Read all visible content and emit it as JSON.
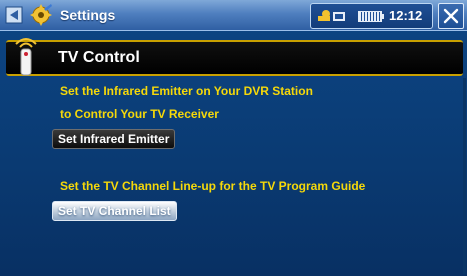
{
  "titlebar": {
    "title": "Settings",
    "clock": "12:12"
  },
  "header": {
    "title": "TV Control"
  },
  "section1": {
    "line1": "Set the Infrared Emitter on Your DVR Station",
    "line2": "to Control Your TV Receiver",
    "button_label": "Set Infrared Emitter"
  },
  "section2": {
    "line1": "Set the TV Channel Line-up for the TV Program Guide",
    "button_label": "Set TV Channel List"
  },
  "colors": {
    "accent_text": "#f5d80a",
    "background": "#0d4685",
    "header_border": "#c8a000"
  },
  "icons": [
    "back-icon",
    "settings-gear-icon",
    "connection-icon",
    "battery-icon",
    "close-icon",
    "tv-remote-icon"
  ]
}
